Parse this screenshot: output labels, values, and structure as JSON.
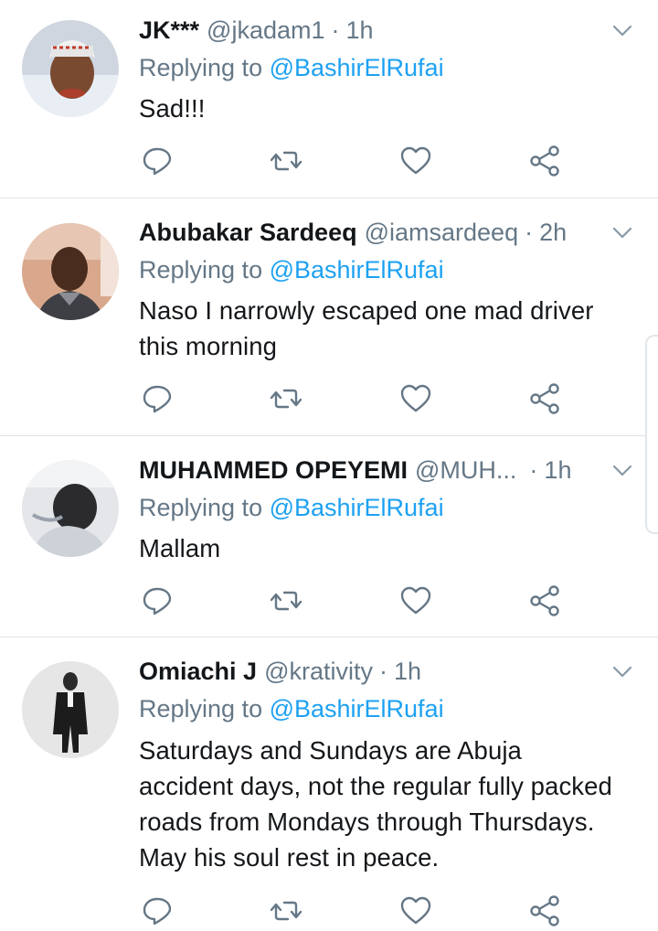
{
  "colors": {
    "text": "#14171a",
    "secondary": "#657786",
    "mention": "#1da1f2",
    "divider": "#dfe4e8"
  },
  "tweets": [
    {
      "name": "JK***",
      "handle": "@jkadam1",
      "dot": "·",
      "time": "1h",
      "replying_prefix": "Replying to ",
      "replying_to": "@BashirElRufai",
      "text": "Sad!!!",
      "avatar_icon": "user-avatar"
    },
    {
      "name": "Abubakar Sardeeq",
      "handle": "@iamsardeeq",
      "dot": "·",
      "time": "2h",
      "replying_prefix": "Replying to ",
      "replying_to": "@BashirElRufai",
      "text": "Naso I narrowly escaped one mad driver this morning",
      "avatar_icon": "user-avatar"
    },
    {
      "name": "MUHAMMED OPEYEMI",
      "handle": "@MUH...",
      "dot": "·",
      "time": "1h",
      "replying_prefix": "Replying to ",
      "replying_to": "@BashirElRufai",
      "text": "Mallam",
      "avatar_icon": "user-avatar"
    },
    {
      "name": "Omiachi J",
      "handle": "@krativity",
      "dot": "·",
      "time": "1h",
      "replying_prefix": "Replying to ",
      "replying_to": "@BashirElRufai",
      "text": "Saturdays and Sundays are Abuja accident days, not the regular fully packed roads from Mondays through Thursdays. May his soul rest in peace.",
      "avatar_icon": "user-avatar"
    }
  ],
  "action_icons": [
    "reply-icon",
    "retweet-icon",
    "like-icon",
    "share-icon"
  ],
  "menu_icon": "chevron-down-icon"
}
